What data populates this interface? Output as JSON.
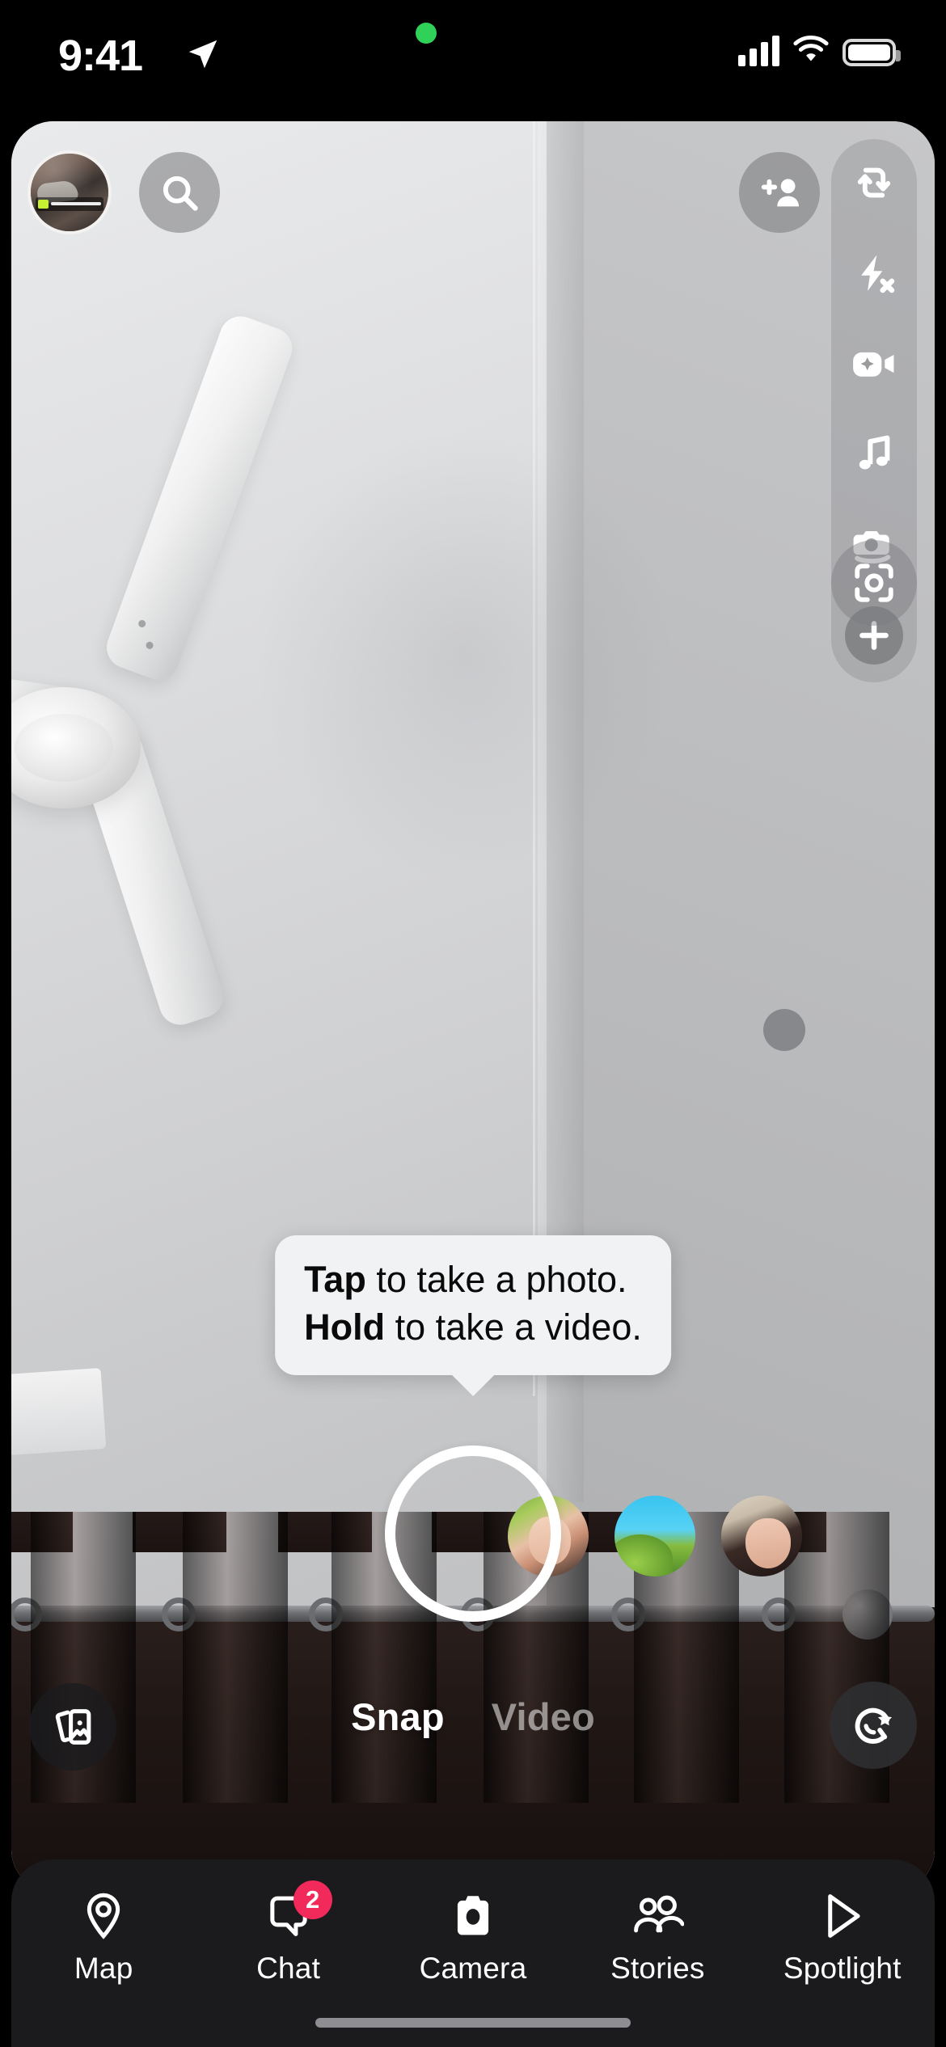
{
  "status_bar": {
    "time": "9:41",
    "location_icon": "location-arrow-icon",
    "recording_dot_color": "#30d158",
    "cellular_icon": "cellular-bars-icon",
    "wifi_icon": "wifi-icon",
    "battery_icon": "battery-full-icon"
  },
  "top_controls": {
    "profile_avatar": "profile-avatar",
    "search_icon": "search-icon",
    "add_friend_icon": "add-friend-icon"
  },
  "tool_rail": {
    "items": [
      {
        "icon": "flip-camera-icon",
        "name": "flip-camera-button"
      },
      {
        "icon": "flash-off-icon",
        "name": "flash-off-button"
      },
      {
        "icon": "ai-video-icon",
        "name": "ai-video-button"
      },
      {
        "icon": "music-note-icon",
        "name": "music-button"
      },
      {
        "icon": "camera-stack-icon",
        "name": "camera-roll-button"
      },
      {
        "icon": "plus-icon",
        "name": "add-lens-button"
      }
    ],
    "scan_icon": "scan-icon"
  },
  "tooltip": {
    "line1_bold": "Tap",
    "line1_rest": " to take a photo.",
    "line2_bold": "Hold",
    "line2_rest": " to take a video."
  },
  "capture": {
    "shutter_name": "shutter-button",
    "memories_icon": "memories-icon",
    "lens_carousel_icon": "lens-smiley-star-icon",
    "stories": [
      {
        "name": "story-thumb-1"
      },
      {
        "name": "story-thumb-2"
      },
      {
        "name": "story-thumb-3"
      }
    ]
  },
  "modes": {
    "active": "Snap",
    "inactive": "Video"
  },
  "tab_bar": {
    "accent_badge_color": "#f2295b",
    "background_color": "#1b1b1d",
    "tabs": [
      {
        "label": "Map",
        "icon": "map-pin-icon",
        "badge": null,
        "active": false
      },
      {
        "label": "Chat",
        "icon": "chat-bubble-icon",
        "badge": "2",
        "active": false
      },
      {
        "label": "Camera",
        "icon": "camera-icon",
        "badge": null,
        "active": true
      },
      {
        "label": "Stories",
        "icon": "people-icon",
        "badge": null,
        "active": false
      },
      {
        "label": "Spotlight",
        "icon": "play-arrow-icon",
        "badge": null,
        "active": false
      }
    ]
  }
}
